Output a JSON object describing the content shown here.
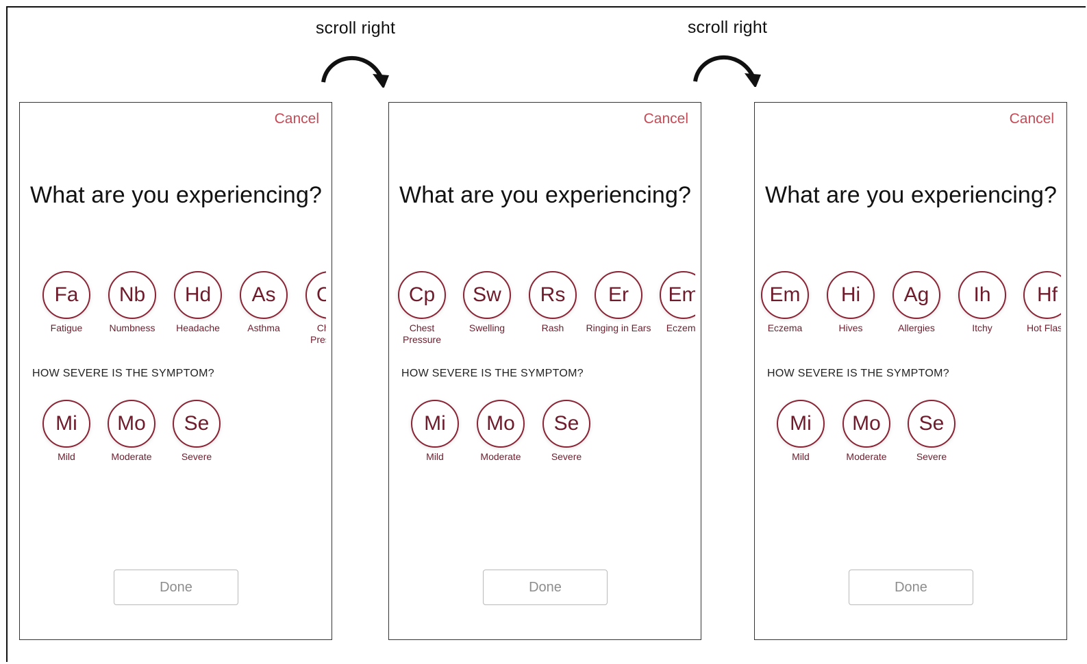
{
  "annotations": [
    {
      "label": "scroll right"
    },
    {
      "label": "scroll right"
    }
  ],
  "screens": [
    {
      "cancel": "Cancel",
      "title": "What are you experiencing?",
      "symptoms": [
        {
          "abbr": "Fa",
          "label": "Fatigue"
        },
        {
          "abbr": "Nb",
          "label": "Numbness"
        },
        {
          "abbr": "Hd",
          "label": "Headache"
        },
        {
          "abbr": "As",
          "label": "Asthma"
        },
        {
          "abbr": "Cp",
          "label": "Chest Pressure"
        }
      ],
      "question": "HOW SEVERE IS THE SYMPTOM?",
      "severity": [
        {
          "abbr": "Mi",
          "label": "Mild"
        },
        {
          "abbr": "Mo",
          "label": "Moderate"
        },
        {
          "abbr": "Se",
          "label": "Severe"
        }
      ],
      "done": "Done"
    },
    {
      "cancel": "Cancel",
      "title": "What are you experiencing?",
      "symptoms": [
        {
          "abbr": "Cp",
          "label": "Chest Pressure"
        },
        {
          "abbr": "Sw",
          "label": "Swelling"
        },
        {
          "abbr": "Rs",
          "label": "Rash"
        },
        {
          "abbr": "Er",
          "label": "Ringing in Ears"
        },
        {
          "abbr": "Em",
          "label": "Eczema"
        }
      ],
      "question": "HOW SEVERE IS THE SYMPTOM?",
      "severity": [
        {
          "abbr": "Mi",
          "label": "Mild"
        },
        {
          "abbr": "Mo",
          "label": "Moderate"
        },
        {
          "abbr": "Se",
          "label": "Severe"
        }
      ],
      "done": "Done"
    },
    {
      "cancel": "Cancel",
      "title": "What are you experiencing?",
      "symptoms": [
        {
          "abbr": "Em",
          "label": "Eczema"
        },
        {
          "abbr": "Hi",
          "label": "Hives"
        },
        {
          "abbr": "Ag",
          "label": "Allergies"
        },
        {
          "abbr": "Ih",
          "label": "Itchy"
        },
        {
          "abbr": "Hf",
          "label": "Hot Flash"
        }
      ],
      "question": "HOW SEVERE IS THE SYMPTOM?",
      "severity": [
        {
          "abbr": "Mi",
          "label": "Mild"
        },
        {
          "abbr": "Mo",
          "label": "Moderate"
        },
        {
          "abbr": "Se",
          "label": "Severe"
        }
      ],
      "done": "Done"
    }
  ],
  "colors": {
    "accent": "#8a2334",
    "accent_text": "#6e1c2c",
    "cancel": "#c44a55",
    "done_border": "#b9b9b9",
    "done_text": "#8d8d8d"
  }
}
